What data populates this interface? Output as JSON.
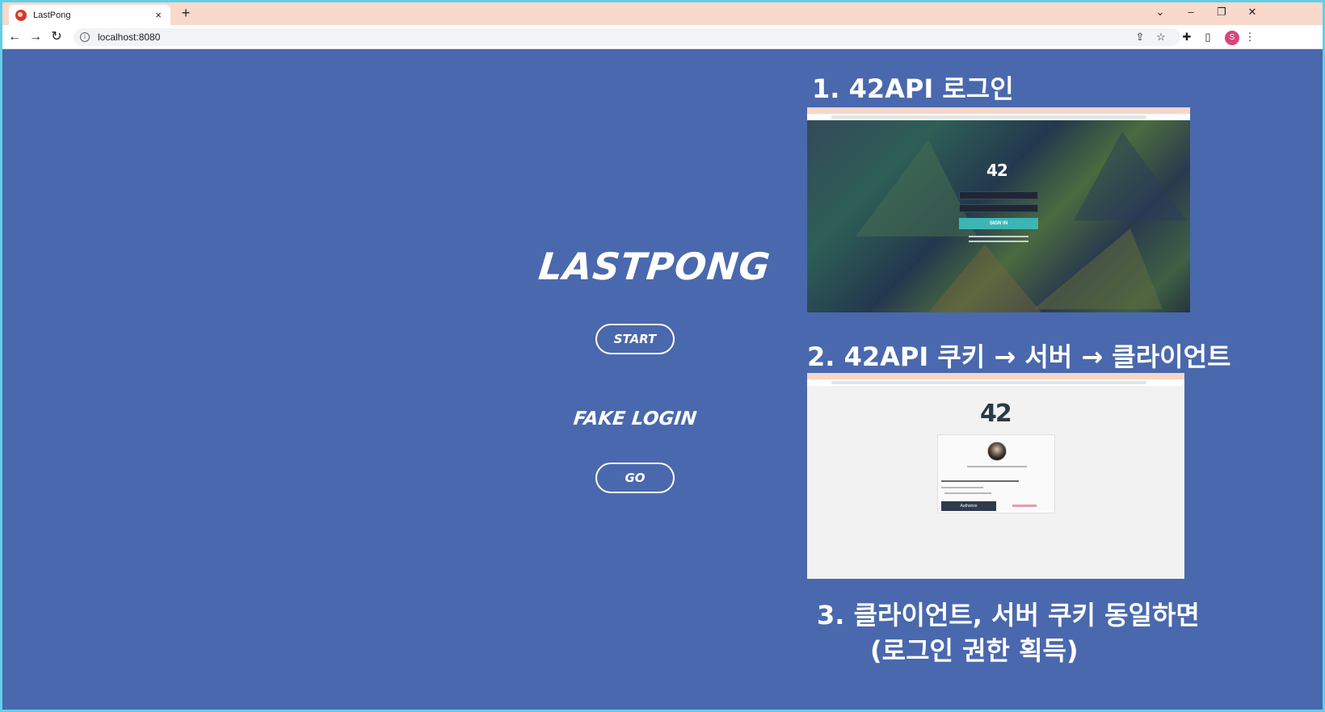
{
  "browser": {
    "tab_title": "LastPong",
    "url": "localhost:8080",
    "profile_initial": "S",
    "new_tab_label": "+",
    "tab_close_label": "×"
  },
  "app": {
    "logo_text": "LASTPONG",
    "start_button_label": "START",
    "fake_login_label": "FAKE LOGIN",
    "go_button_label": "GO"
  },
  "steps": {
    "step1": "1. 42API 로그인",
    "step2": "2. 42API 쿠키 → 서버 → 클라이언트",
    "step3_line1": "3. 클라이언트, 서버 쿠키 동일하면",
    "step3_line2": "(로그인 권한 획득)"
  },
  "screenshot1": {
    "logo": "42",
    "sign_in_label": "SIGN IN"
  },
  "screenshot2": {
    "logo": "42",
    "authorize_label": "Authorize"
  },
  "colors": {
    "page_bg": "#4a68ad",
    "tabstrip_bg": "#f9d9cc",
    "frame_border": "#5fd0e8",
    "sign_in_button": "#3cb6b4",
    "authorize_button": "#2f3b4c"
  },
  "icons": [
    "back-arrow-icon",
    "forward-arrow-icon",
    "reload-icon",
    "info-icon",
    "share-icon",
    "star-icon",
    "extensions-icon",
    "side-panel-icon",
    "menu-dots-icon"
  ]
}
